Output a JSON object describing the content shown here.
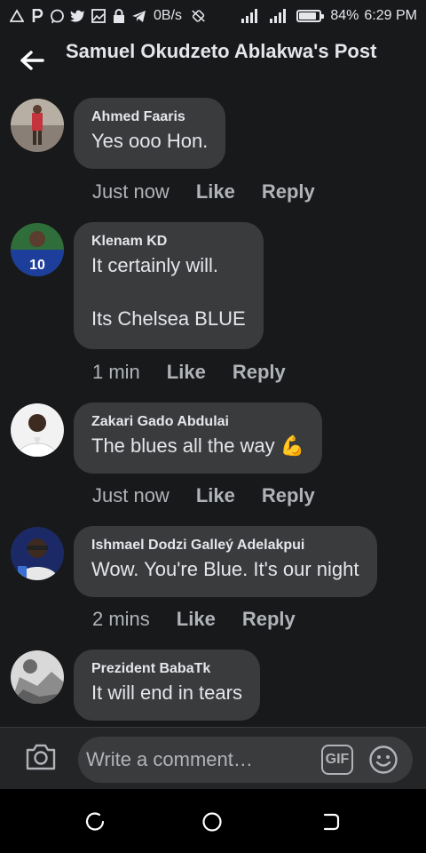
{
  "status_bar": {
    "network_speed": "0B/s",
    "battery_percent": "84%",
    "battery_level": 0.84,
    "time": "6:29 PM",
    "left_icons": [
      "warning-triangle-icon",
      "parking-icon",
      "whatsapp-icon",
      "twitter-icon",
      "image-icon",
      "lock-icon",
      "telegram-icon"
    ],
    "right_icons": [
      "mute-icon",
      "signal-icon",
      "signal-icon",
      "battery-icon"
    ]
  },
  "header": {
    "title": "Samuel Okudzeto Ablakwa's Post",
    "back_icon": "back-arrow-icon"
  },
  "comments": [
    {
      "author": "Ahmed Faaris",
      "text": "Yes ooo Hon.",
      "time": "Just now",
      "like": "Like",
      "reply": "Reply"
    },
    {
      "author": "Klenam KD",
      "text": "It certainly will.\n\nIts Chelsea BLUE",
      "time": "1 min",
      "like": "Like",
      "reply": "Reply"
    },
    {
      "author": "Zakari Gado Abdulai",
      "text": "The blues all the way 💪",
      "time": "Just now",
      "like": "Like",
      "reply": "Reply"
    },
    {
      "author": "Ishmael Dodzi Galleý Adelakpui",
      "text": "Wow. You're Blue. It's our night",
      "time": "2 mins",
      "like": "Like",
      "reply": "Reply"
    },
    {
      "author": "Prezident BabaTk",
      "text": "It will end in tears"
    }
  ],
  "composer": {
    "placeholder": "Write a comment…",
    "gif_label": "GIF",
    "camera_icon": "camera-icon",
    "emoji_icon": "emoji-icon"
  },
  "nav": {
    "recents_icon": "recents-icon",
    "home_icon": "home-circle-icon",
    "back_icon": "back-nav-icon"
  },
  "colors": {
    "background": "#18191a",
    "bubble": "#3a3b3c",
    "text": "#e4e6eb",
    "secondary_text": "#b0b3b8",
    "navbar": "#000000"
  }
}
